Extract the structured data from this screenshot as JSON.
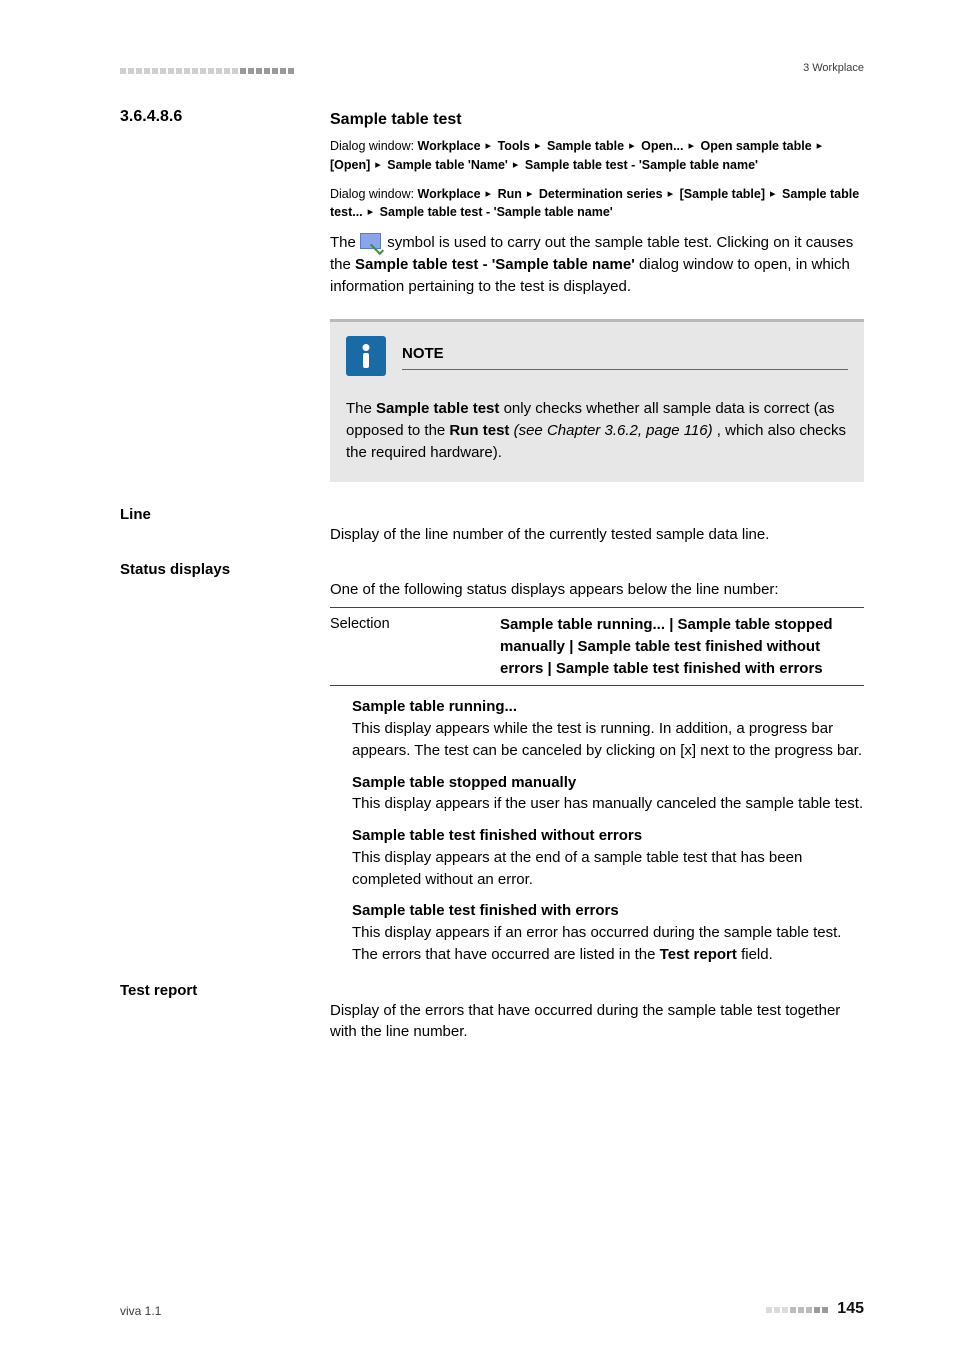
{
  "header": {
    "right": "3 Workplace"
  },
  "section": {
    "number": "3.6.4.8.6",
    "title": "Sample table test"
  },
  "dialog1_prefix": "Dialog window: ",
  "dialog1_parts": [
    "Workplace",
    "Tools",
    "Sample table",
    "Open...",
    "Open sample table",
    "[Open]",
    "Sample table 'Name'",
    "Sample table test - 'Sample table name'"
  ],
  "dialog2_prefix": "Dialog window: ",
  "dialog2_parts": [
    "Workplace",
    "Run",
    "Determination series",
    "[Sample table]",
    "Sample table test...",
    "Sample table test - 'Sample table name'"
  ],
  "intro_1a": "The ",
  "intro_1b": " symbol is used to carry out the sample table test. Clicking on it causes the ",
  "intro_1c": "Sample table test - 'Sample table name'",
  "intro_1d": " dialog window to open, in which information pertaining to the test is displayed.",
  "note": {
    "title": "NOTE",
    "body_a": "The ",
    "body_b": "Sample table test",
    "body_c": " only checks whether all sample data is correct (as opposed to the ",
    "body_d": "Run test",
    "body_e": " (see Chapter 3.6.2, page 116)",
    "body_f": ", which also checks the required hardware)."
  },
  "line": {
    "label": "Line",
    "text": "Display of the line number of the currently tested sample data line."
  },
  "status": {
    "label": "Status displays",
    "intro": "One of the following status displays appears below the line number:",
    "selection_label": "Selection",
    "selection_value": "Sample table running... | Sample table stopped manually | Sample table test finished without errors | Sample table test finished with errors",
    "items": [
      {
        "title": "Sample table running...",
        "body": "This display appears while the test is running. In addition, a progress bar appears. The test can be canceled by clicking on [x] next to the progress bar."
      },
      {
        "title": "Sample table stopped manually",
        "body": "This display appears if the user has manually canceled the sample table test."
      },
      {
        "title": "Sample table test finished without errors",
        "body": "This display appears at the end of a sample table test that has been completed without an error."
      },
      {
        "title": "Sample table test finished with errors",
        "body_a": "This display appears if an error has occurred during the sample table test. The errors that have occurred are listed in the ",
        "body_b": "Test report",
        "body_c": " field."
      }
    ]
  },
  "testreport": {
    "label": "Test report",
    "text": "Display of the errors that have occurred during the sample table test together with the line number."
  },
  "footer": {
    "left": "viva 1.1",
    "page": "145"
  }
}
